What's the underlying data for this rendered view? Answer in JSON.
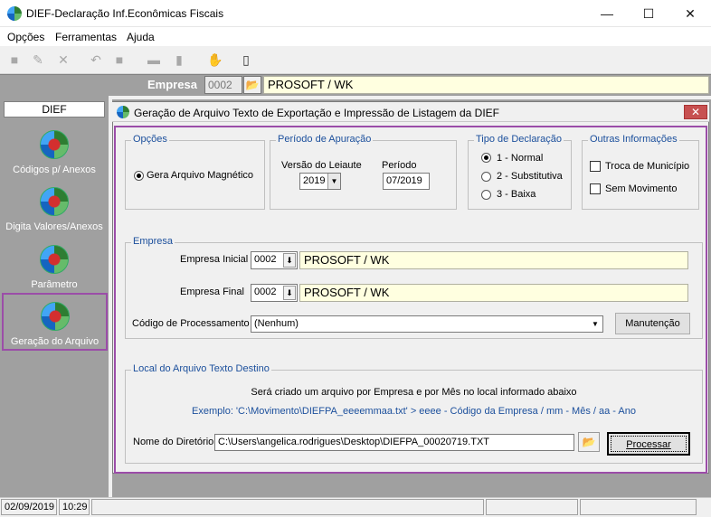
{
  "window": {
    "title": "DIEF-Declaração Inf.Econômicas Fiscais",
    "minimize": "—",
    "maximize": "☐",
    "close": "✕"
  },
  "menu": [
    {
      "label": "Opções"
    },
    {
      "label": "Ferramentas"
    },
    {
      "label": "Ajuda"
    }
  ],
  "empresa_bar": {
    "label": "Empresa",
    "code": "0002",
    "name": "PROSOFT / WK"
  },
  "sidebar": {
    "header": "DIEF",
    "items": [
      {
        "label": "Códigos p/ Anexos"
      },
      {
        "label": "Digita Valores/Anexos"
      },
      {
        "label": "Parâmetro"
      },
      {
        "label": "Geração do Arquivo"
      }
    ]
  },
  "dialog": {
    "title": "Geração de Arquivo Texto de Exportação e Impressão de Listagem da DIEF",
    "opcoes": {
      "legend": "Opções",
      "radio_label": "Gera Arquivo Magnético"
    },
    "periodo": {
      "legend": "Período de Apuração",
      "versao_label": "Versão do Leiaute",
      "versao_value": "2019",
      "periodo_label": "Período",
      "periodo_value": "07/2019"
    },
    "tipo": {
      "legend": "Tipo de Declaração",
      "options": [
        "1 - Normal",
        "2 - Substitutiva",
        "3 - Baixa"
      ],
      "selected_index": 0
    },
    "outras": {
      "legend": "Outras Informações",
      "troca_label": "Troca de Município",
      "sem_mov_label": "Sem Movimento"
    },
    "empresa": {
      "legend": "Empresa",
      "inicial_label": "Empresa Inicial",
      "inicial_code": "0002",
      "inicial_name": "PROSOFT / WK",
      "final_label": "Empresa Final",
      "final_code": "0002",
      "final_name": "PROSOFT / WK",
      "processamento_label": "Código de Processamento",
      "processamento_value": "(Nenhum)",
      "manutencao_button": "Manutenção"
    },
    "local": {
      "legend": "Local do Arquivo Texto Destino",
      "info_text": "Será criado um arquivo por Empresa e por Mês no local informado abaixo",
      "example_text": "Exemplo: 'C:\\Movimento\\DIEFPA_eeeemmaa.txt' > eeee - Código da Empresa / mm - Mês / aa - Ano",
      "dir_label": "Nome do Diretório",
      "dir_value": "C:\\Users\\angelica.rodrigues\\Desktop\\DIEFPA_00020719.TXT",
      "processar_button": "Processar"
    }
  },
  "status": {
    "date": "02/09/2019",
    "time": "10:29"
  },
  "colors": {
    "highlight": "#9b4da8",
    "legend_blue": "#1b4f9c",
    "yellow_field": "#ffffe0",
    "panel_gray": "#a0a0a0"
  }
}
